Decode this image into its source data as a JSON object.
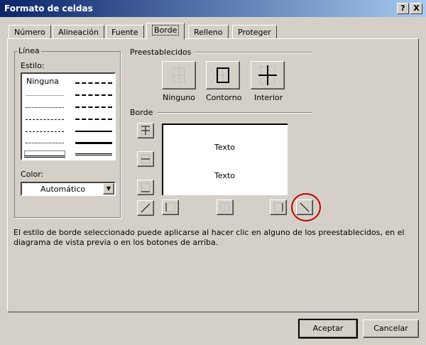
{
  "window": {
    "title": "Formato de celdas",
    "help_label": "?",
    "close_label": "X"
  },
  "tabs": [
    {
      "label": "Número"
    },
    {
      "label": "Alineación"
    },
    {
      "label": "Fuente"
    },
    {
      "label": "Borde",
      "active": true
    },
    {
      "label": "Relleno"
    },
    {
      "label": "Proteger"
    }
  ],
  "line": {
    "group_label": "Línea",
    "style_label": "Estilo:",
    "none_label": "Ninguna",
    "color_label": "Color:",
    "color_value": "Automático"
  },
  "presets": {
    "label": "Preestablecidos",
    "items": [
      {
        "label": "Ninguno"
      },
      {
        "label": "Contorno"
      },
      {
        "label": "Interior"
      }
    ]
  },
  "border": {
    "label": "Borde",
    "preview_text_top": "Texto",
    "preview_text_bottom": "Texto",
    "highlight_color": "#c00000"
  },
  "description": "El estilo de borde seleccionado puede aplicarse al hacer clic en alguno de los preestablecidos, en el diagrama de vista previa o en los botones de arriba.",
  "buttons": {
    "ok": "Aceptar",
    "cancel": "Cancelar"
  }
}
